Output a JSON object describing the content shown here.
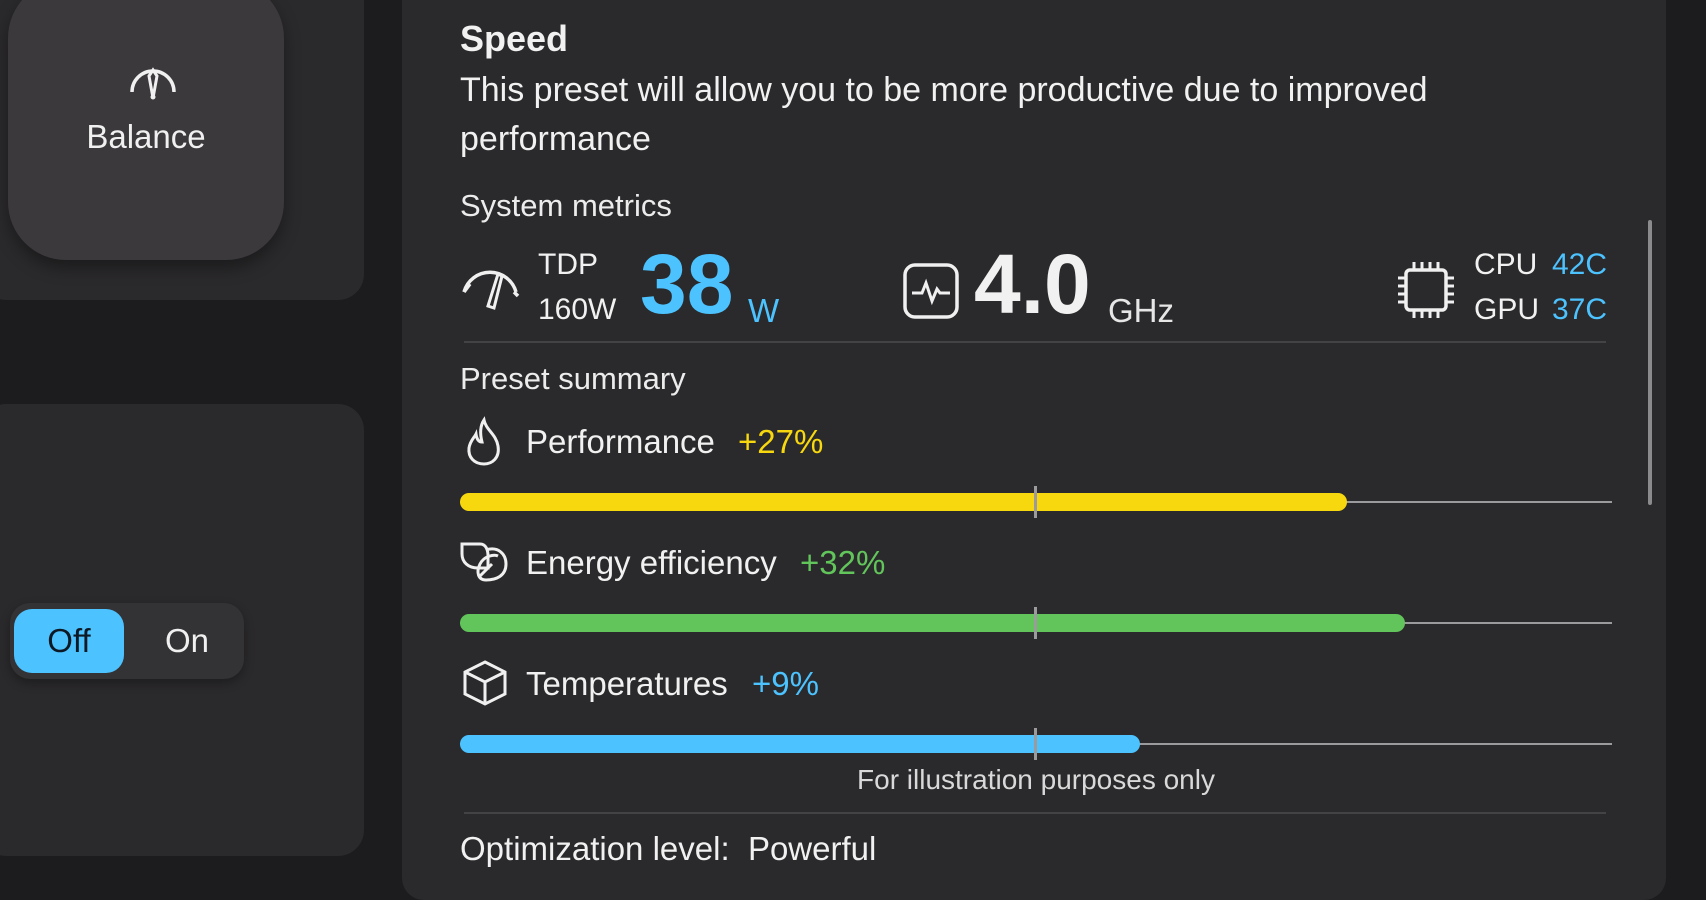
{
  "left": {
    "preset_tile": {
      "label": "Balance",
      "icon": "gauge-icon"
    },
    "toggle": {
      "off_label": "Off",
      "on_label": "On",
      "selected": "Off"
    }
  },
  "preset": {
    "title": "Speed",
    "description": "This preset will allow you to be more productive due to improved performance"
  },
  "metrics": {
    "section_label": "System metrics",
    "tdp": {
      "label": "TDP",
      "max": "160W",
      "value": "38",
      "unit": "W",
      "icon": "speedometer-icon"
    },
    "frequency": {
      "value": "4.0",
      "unit": "GHz",
      "icon": "activity-monitor-icon"
    },
    "temps": {
      "icon": "chip-icon",
      "cpu_label": "CPU",
      "cpu_value": "42C",
      "gpu_label": "GPU",
      "gpu_value": "37C"
    }
  },
  "summary": {
    "section_label": "Preset summary",
    "items": [
      {
        "label": "Performance",
        "change": "+27%",
        "level": 0.77,
        "color": "#f7d80f",
        "icon": "flame-icon"
      },
      {
        "label": "Energy efficiency",
        "change": "+32%",
        "level": 0.82,
        "color": "#62c55b",
        "icon": "leaf-icon"
      },
      {
        "label": "Temperatures",
        "change": "+9%",
        "level": 0.59,
        "color": "#4cc2ff",
        "icon": "cube-icon"
      }
    ],
    "note": "For illustration purposes only"
  },
  "optimization": {
    "text": "Optimization level:  Powerful"
  },
  "colors": {
    "accent": "#4cc2ff",
    "performance": "#f7d80f",
    "efficiency": "#62c55b",
    "temperature": "#4cc2ff"
  }
}
